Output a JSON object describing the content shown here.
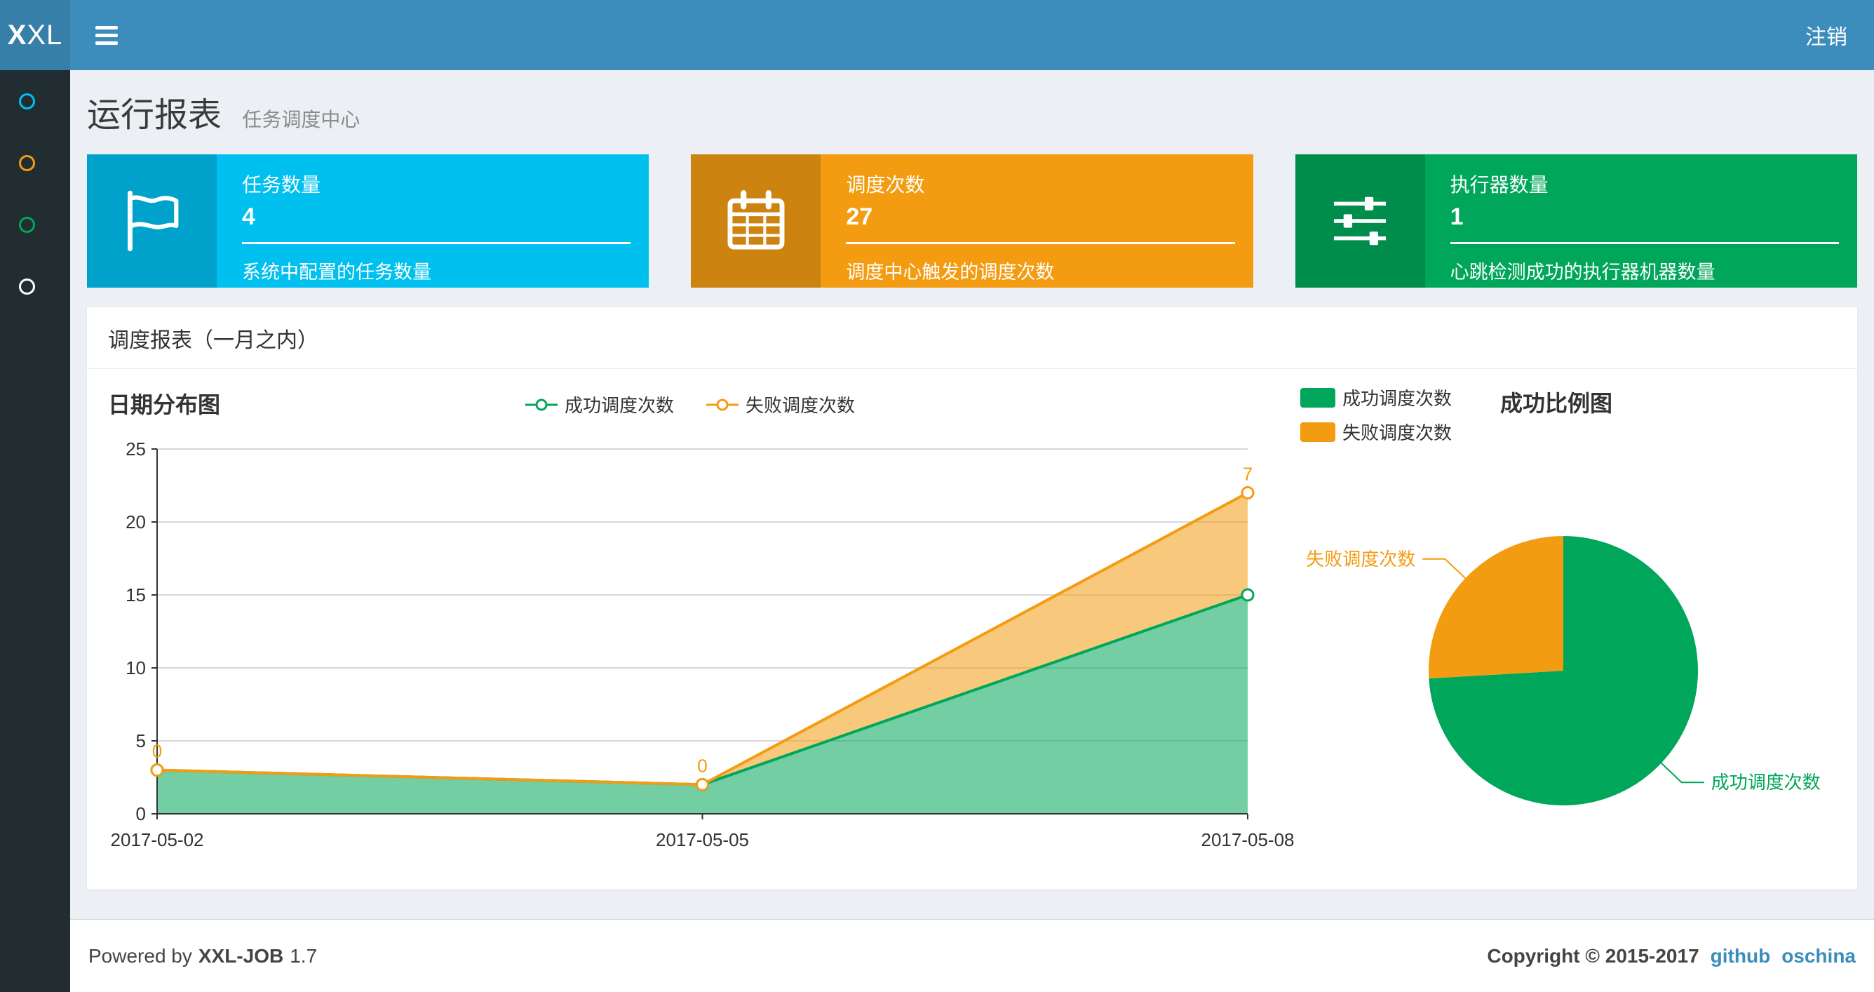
{
  "theme": {
    "navbar_bg": "#3c8dbc",
    "logo_bg": "#367fa9",
    "sidebar_bg": "#222d32",
    "content_bg": "#ecf0f5",
    "link_color": "#3c8dbc"
  },
  "navbar": {
    "logo_bold": "X",
    "logo_rest": "XL",
    "logout_label": "注销"
  },
  "sidebar": {
    "items": [
      {
        "icon": "circle-icon",
        "color": "#00c0ef"
      },
      {
        "icon": "circle-icon",
        "color": "#f39c12"
      },
      {
        "icon": "circle-icon",
        "color": "#00a65a"
      },
      {
        "icon": "circle-icon",
        "color": "#ffffff"
      }
    ]
  },
  "header": {
    "title": "运行报表",
    "subtitle": "任务调度中心"
  },
  "info_boxes": [
    {
      "title": "任务数量",
      "value": "4",
      "desc": "系统中配置的任务数量",
      "color": "#00c0ef",
      "icon_color": "#00a2cc",
      "icon": "flag-icon"
    },
    {
      "title": "调度次数",
      "value": "27",
      "desc": "调度中心触发的调度次数",
      "color": "#f39c12",
      "icon_color": "#cc830f",
      "icon": "calendar-icon"
    },
    {
      "title": "执行器数量",
      "value": "1",
      "desc": "心跳检测成功的执行器机器数量",
      "color": "#00a65a",
      "icon_color": "#008d4c",
      "icon": "sliders-icon"
    }
  ],
  "panel": {
    "title": "调度报表（一月之内）"
  },
  "chart_data": [
    {
      "type": "area",
      "title": "日期分布图",
      "x": [
        "2017-05-02",
        "2017-05-05",
        "2017-05-08"
      ],
      "series": [
        {
          "name": "成功调度次数",
          "values": [
            3,
            2,
            15
          ],
          "color": "#00a65a"
        },
        {
          "name": "失败调度次数",
          "values": [
            0,
            0,
            7
          ],
          "color": "#f39c12",
          "point_labels": [
            "0",
            "0",
            "7"
          ]
        }
      ],
      "stacked": true,
      "ylim": [
        0,
        25
      ],
      "yticks": [
        0,
        5,
        10,
        15,
        20,
        25
      ],
      "grid": true,
      "legend_position": "top"
    },
    {
      "type": "pie",
      "title": "成功比例图",
      "slices": [
        {
          "label": "成功调度次数",
          "value": 20,
          "color": "#00a65a"
        },
        {
          "label": "失败调度次数",
          "value": 7,
          "color": "#f39c12"
        }
      ],
      "legend_position": "top-left"
    }
  ],
  "footer": {
    "powered_prefix": "Powered by",
    "app_name": "XXL-JOB",
    "version": "1.7",
    "copyright": "Copyright © 2015-2017",
    "links": [
      {
        "label": "github"
      },
      {
        "label": "oschina"
      }
    ]
  }
}
